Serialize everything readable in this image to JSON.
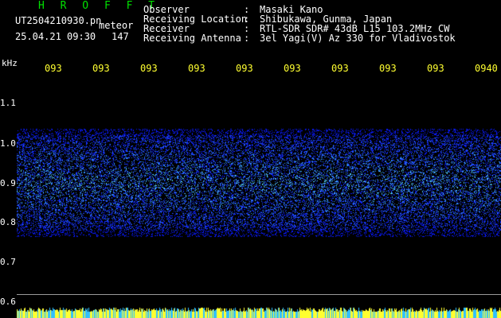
{
  "header": {
    "brand": "H R O F F T",
    "filename": "UT2504210930.pn",
    "tag": "meteor",
    "datetime": "25.04.21 09:30",
    "count": "147",
    "fields": [
      {
        "label": "Observer",
        "value": "Masaki Kano"
      },
      {
        "label": "Receiving Location",
        "value": "Shibukawa, Gunma, Japan"
      },
      {
        "label": "Receiver",
        "value": "RTL-SDR SDR# 43dB L15 103.2MHz CW"
      },
      {
        "label": "Receiving Antenna",
        "value": "3el Yagi(V) Az 330 for Vladivostok"
      }
    ],
    "separator": ":"
  },
  "axis": {
    "unit": "kHz",
    "y_ticks": [
      "1.1",
      "1.0",
      "0.9",
      "0.8",
      "0.7",
      "0.6"
    ],
    "x_ticks": [
      "093",
      "093",
      "093",
      "093",
      "093",
      "093",
      "093",
      "093",
      "093",
      "0940"
    ]
  },
  "spectrogram": {
    "band_low_khz": 0.78,
    "band_high_khz": 1.02,
    "reference_line_khz": 0.62,
    "background_color": "#000000",
    "noise_colors": [
      "#0a1aff",
      "#1e40ff",
      "#2a6bff",
      "#3aa8ff",
      "#60e0ff"
    ],
    "strip_colors": [
      "#ffff30",
      "#30c0ff"
    ]
  }
}
